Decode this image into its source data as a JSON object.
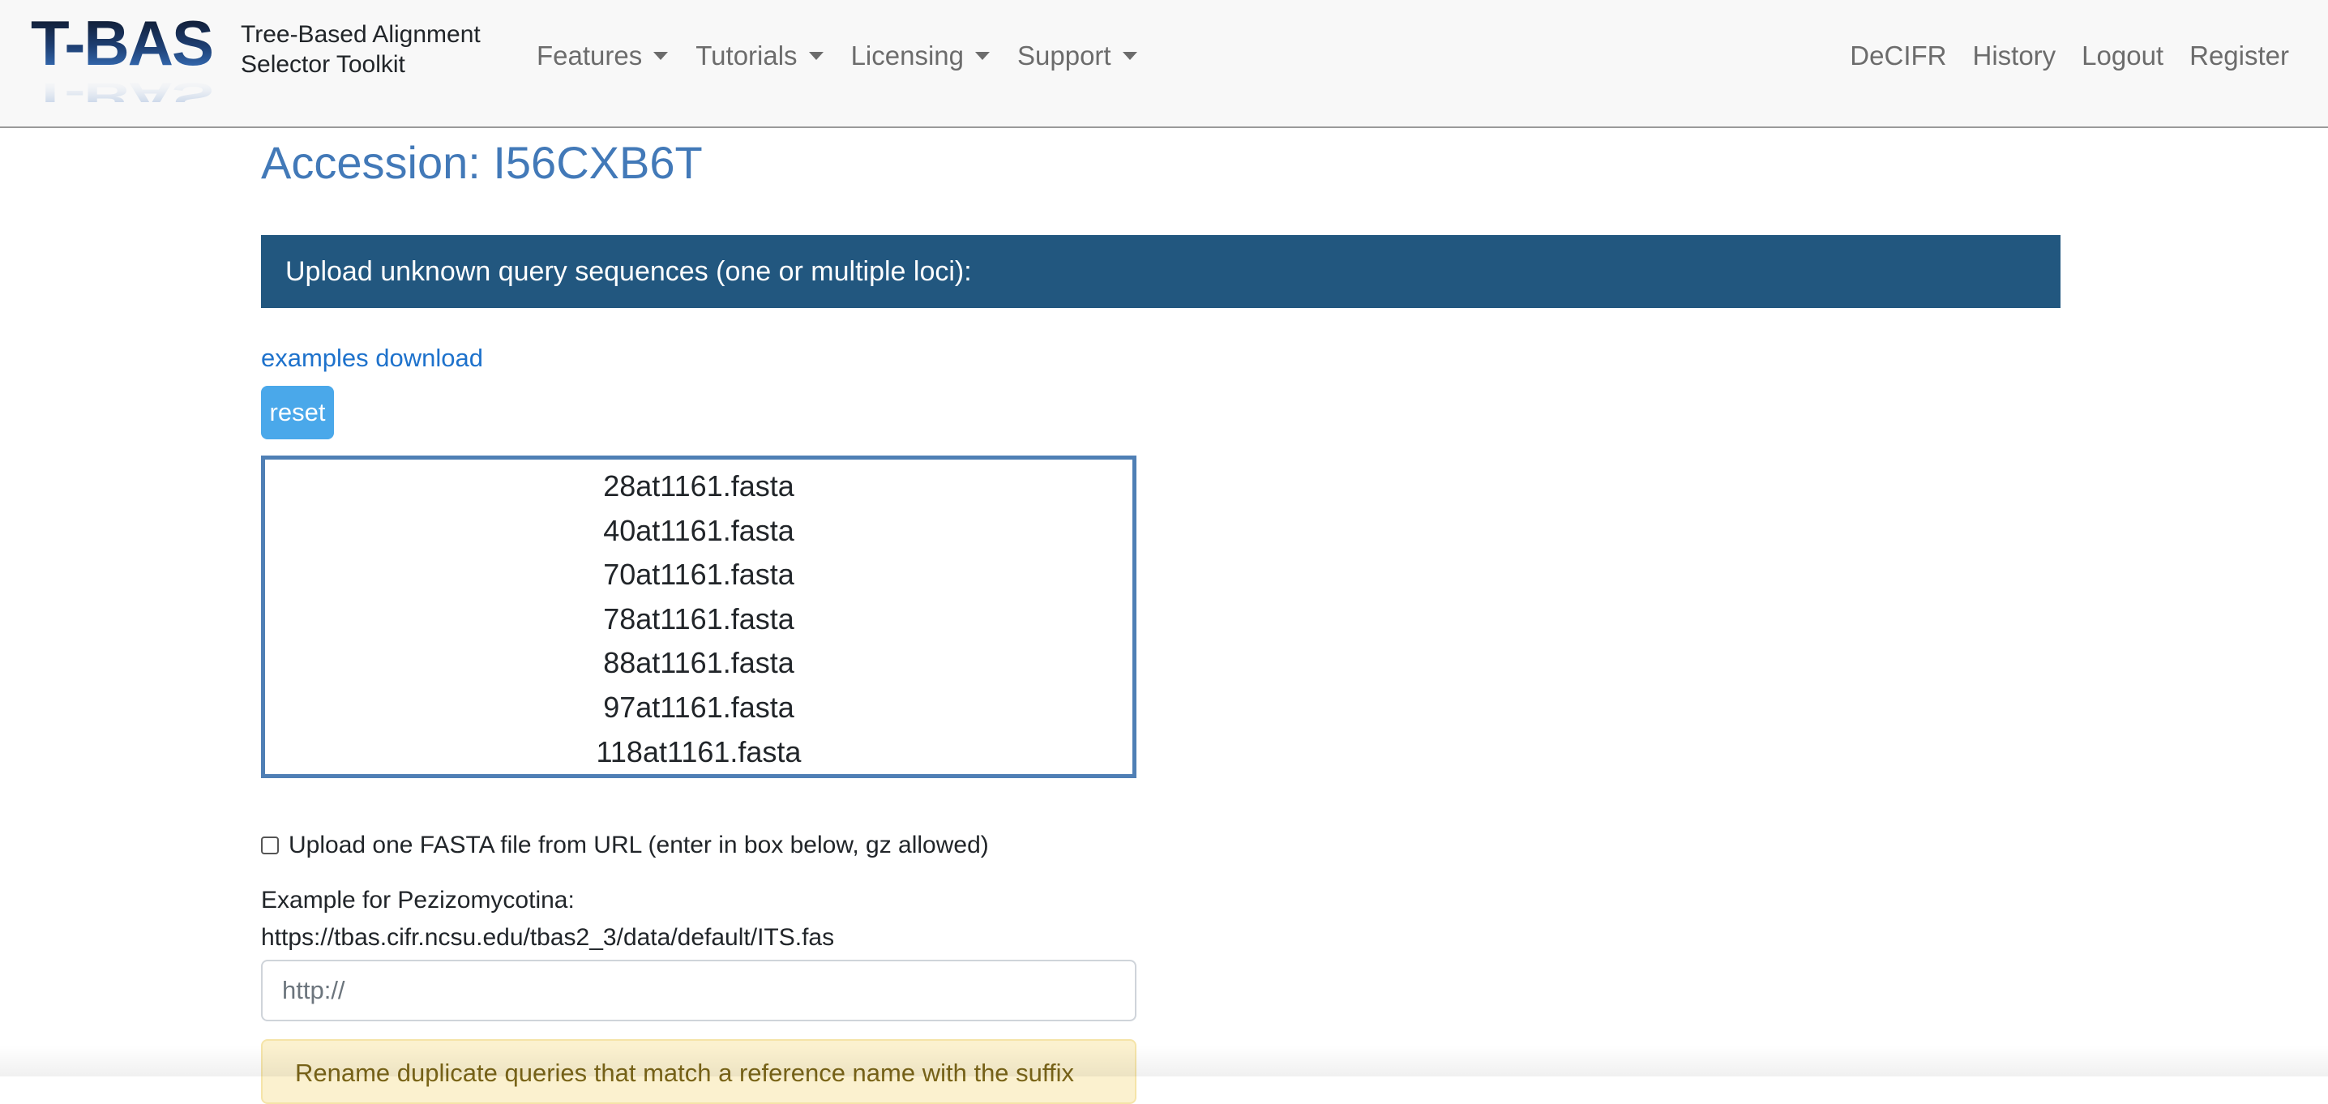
{
  "brand": {
    "logo_text": "T-BAS",
    "subtitle_line1": "Tree-Based Alignment",
    "subtitle_line2": "Selector Toolkit"
  },
  "nav": {
    "left": [
      {
        "label": "Features"
      },
      {
        "label": "Tutorials"
      },
      {
        "label": "Licensing"
      },
      {
        "label": "Support"
      }
    ],
    "right": [
      {
        "label": "DeCIFR"
      },
      {
        "label": "History"
      },
      {
        "label": "Logout"
      },
      {
        "label": "Register"
      }
    ]
  },
  "page": {
    "title": "Accession: I56CXB6T",
    "panel_header": "Upload unknown query sequences (one or multiple loci):",
    "examples_link": "examples download",
    "reset_label": "reset",
    "files": [
      "28at1161.fasta",
      "40at1161.fasta",
      "70at1161.fasta",
      "78at1161.fasta",
      "88at1161.fasta",
      "97at1161.fasta",
      "118at1161.fasta"
    ],
    "url_checkbox_label": "Upload one FASTA file from URL (enter in box below, gz allowed)",
    "url_checked": false,
    "example_label": "Example for Pezizomycotina:",
    "example_url": "https://tbas.cifr.ncsu.edu/tbas2_3/data/default/ITS.fas",
    "url_input_value": "",
    "url_input_placeholder": "http://",
    "warning_text": "Rename duplicate queries that match a reference name with the suffix"
  },
  "colors": {
    "title": "#4279b8",
    "panel_header_bg": "#22577f",
    "link": "#1e72cc",
    "reset_bg": "#4aa8ea",
    "list_border": "#4f7fb5",
    "warning_bg": "#fbf1cf"
  },
  "icons": {
    "dropdown": "caret-down-icon",
    "checkbox": "checkbox-unchecked"
  }
}
